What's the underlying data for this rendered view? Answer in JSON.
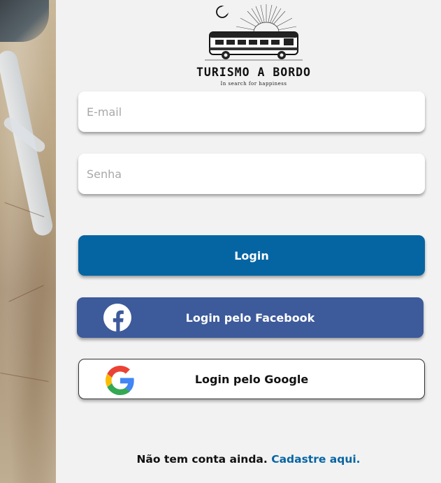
{
  "logo": {
    "title": "TURISMO A BORDO",
    "subtitle": "In search for happiness",
    "icon": "bus-logo-icon"
  },
  "form": {
    "email_placeholder": "E-mail",
    "password_placeholder": "Senha"
  },
  "buttons": {
    "login_label": "Login",
    "facebook_label": "Login pelo Facebook",
    "google_label": "Login pelo Google"
  },
  "signup": {
    "prompt": "Não tem conta ainda.",
    "link": "Cadastre aqui."
  },
  "colors": {
    "primary": "#0565a3",
    "facebook": "#3d5a9b",
    "background": "#f2f2f2"
  }
}
